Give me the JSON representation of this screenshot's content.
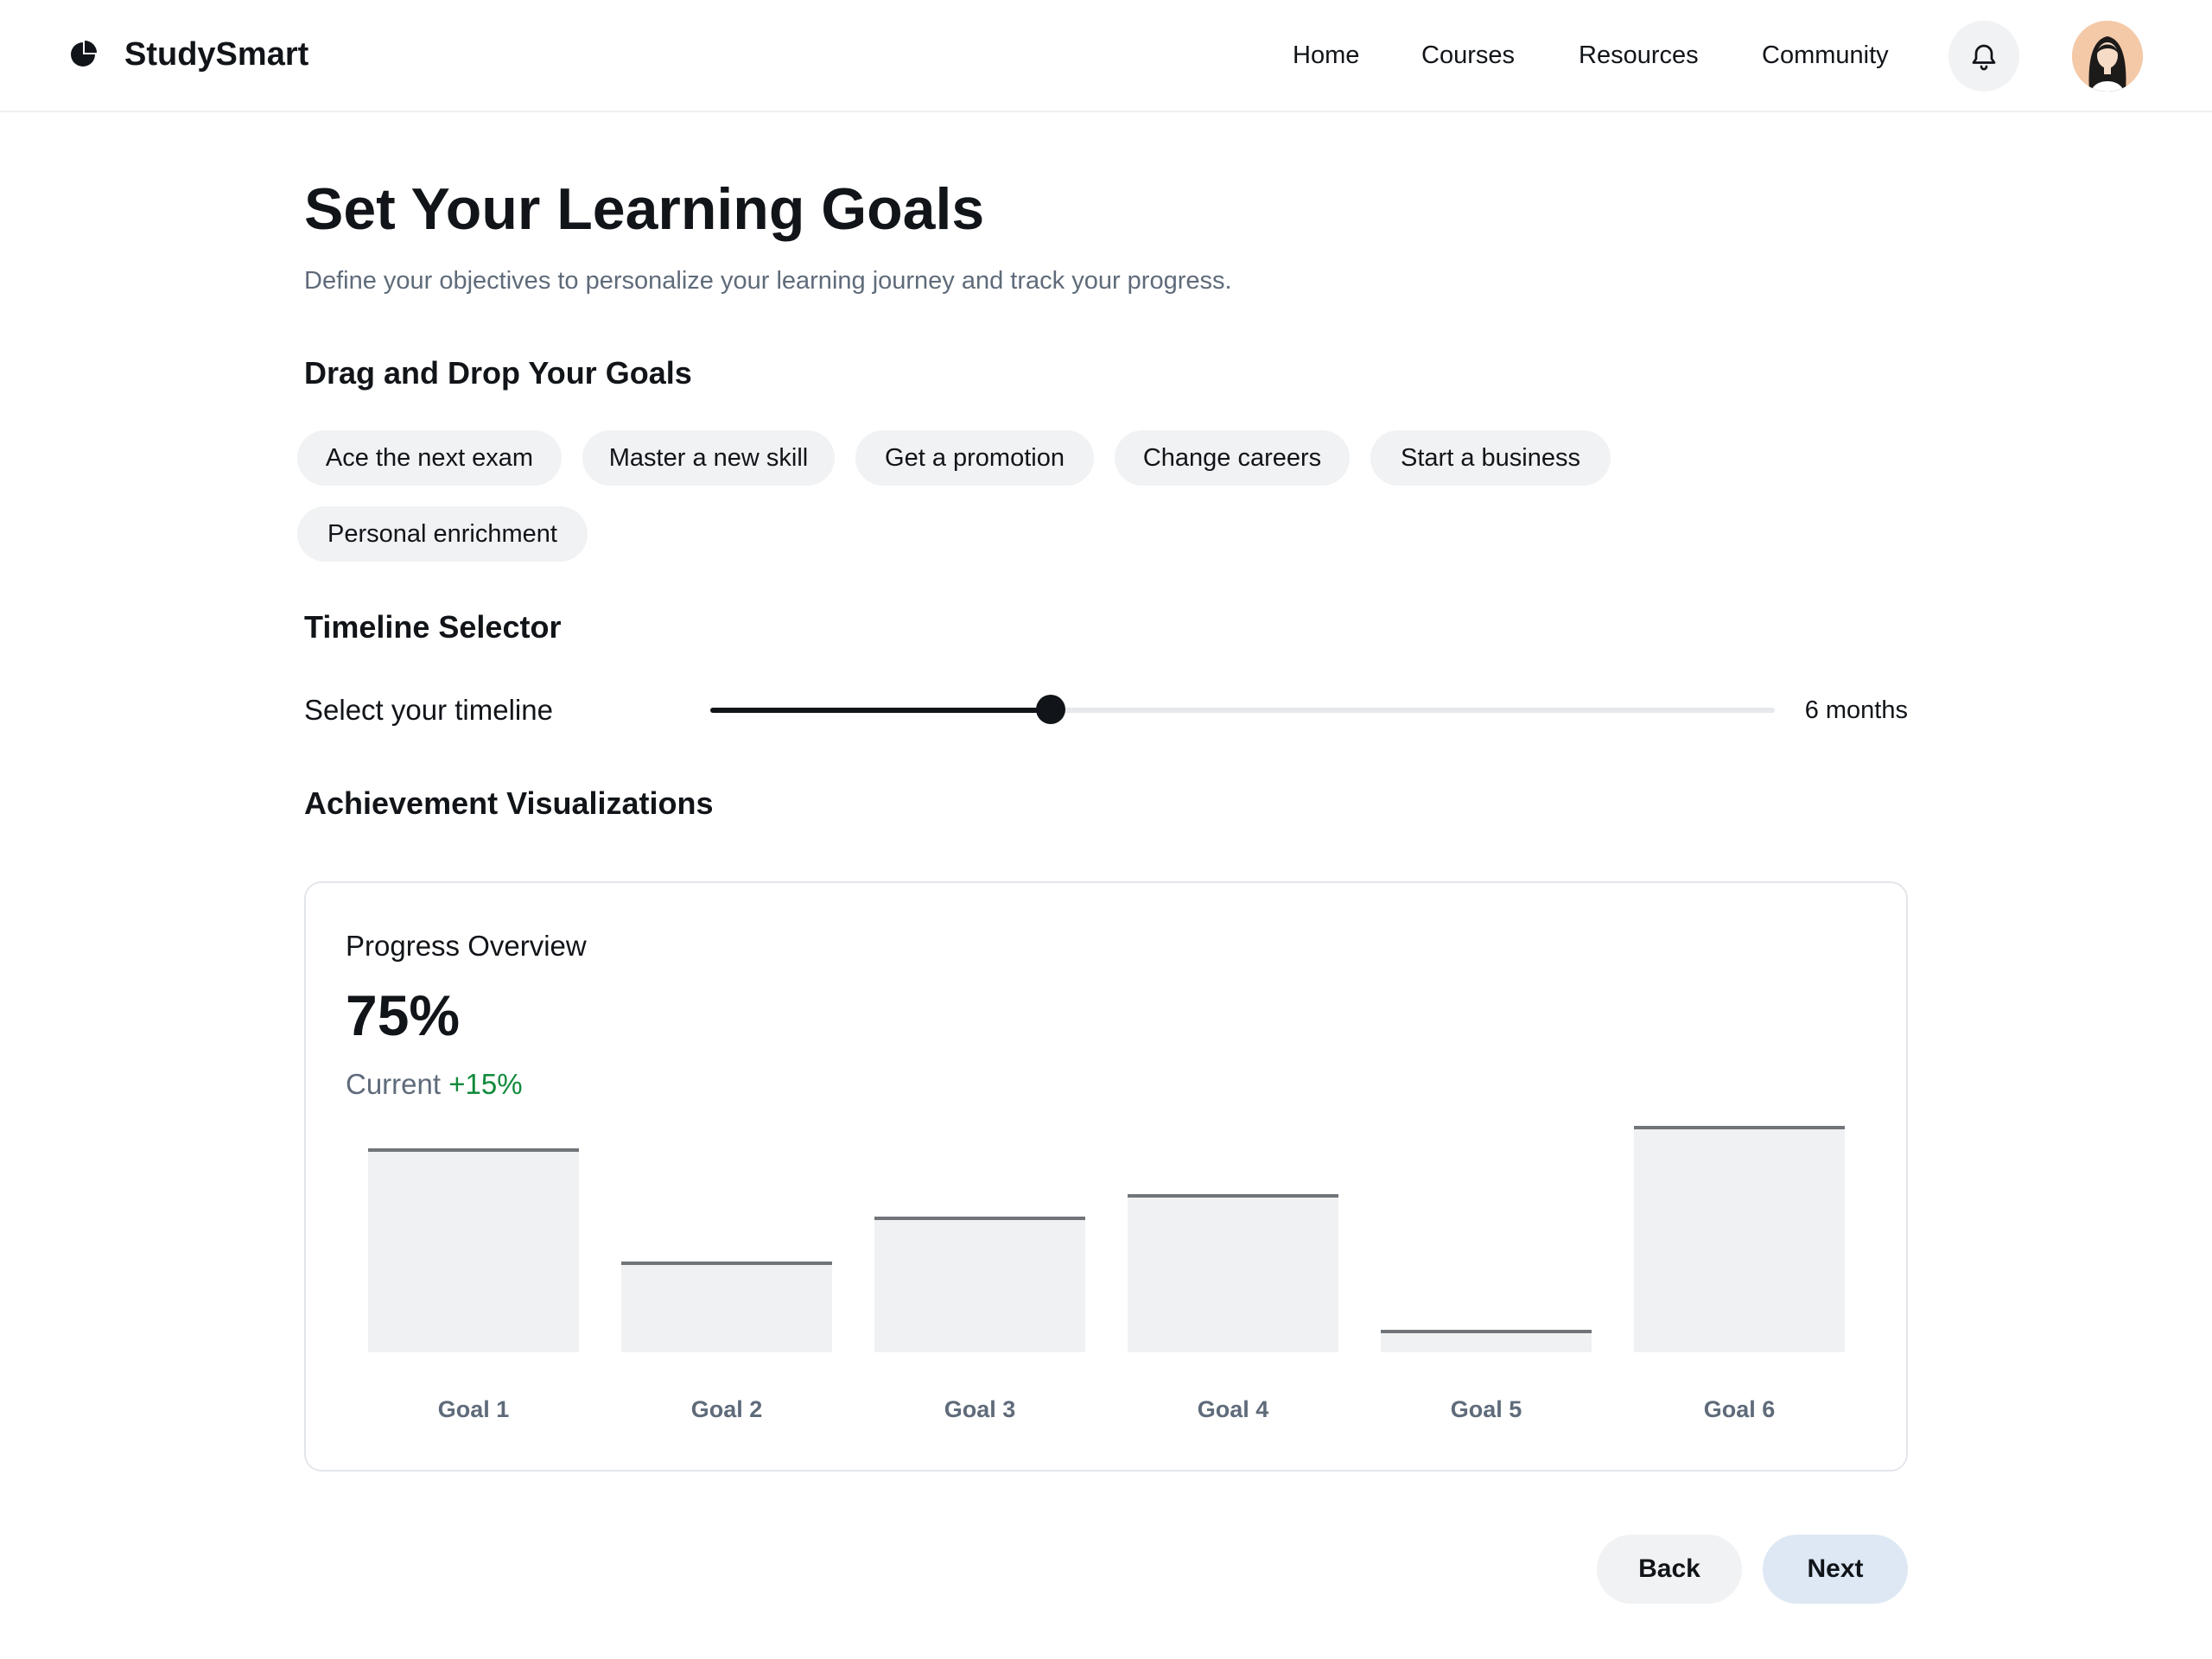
{
  "header": {
    "brand": "StudySmart",
    "nav": [
      "Home",
      "Courses",
      "Resources",
      "Community"
    ],
    "icons": {
      "logo": "logo-icon",
      "notifications": "bell-icon",
      "avatar": "user-avatar"
    }
  },
  "main": {
    "title": "Set Your Learning Goals",
    "subtitle": "Define your objectives to personalize your learning journey and track your progress.",
    "goals_heading": "Drag and Drop Your Goals",
    "goals": [
      "Ace the next exam",
      "Master a new skill",
      "Get a promotion",
      "Change careers",
      "Start a business",
      "Personal enrichment"
    ],
    "timeline_heading": "Timeline Selector",
    "timeline_label": "Select your timeline",
    "timeline_value": "6 months",
    "timeline_fraction": 0.32,
    "viz_heading": "Achievement Visualizations"
  },
  "card": {
    "title": "Progress Overview",
    "value": "75%",
    "current_label": "Current",
    "delta": "+15%",
    "delta_color": "#118a3b"
  },
  "chart_data": {
    "type": "bar",
    "categories": [
      "Goal 1",
      "Goal 2",
      "Goal 3",
      "Goal 4",
      "Goal 5",
      "Goal 6"
    ],
    "values": [
      90,
      40,
      60,
      70,
      10,
      100
    ],
    "ylim": [
      0,
      100
    ],
    "grid": false
  },
  "actions": {
    "back": "Back",
    "next": "Next"
  }
}
